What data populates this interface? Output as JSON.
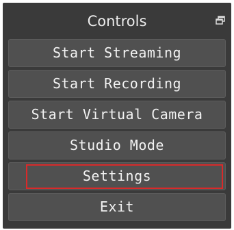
{
  "panel": {
    "title": "Controls",
    "undock_icon": "undock-float-icon"
  },
  "buttons": [
    {
      "label": "Start Streaming"
    },
    {
      "label": "Start Recording"
    },
    {
      "label": "Start Virtual Camera"
    },
    {
      "label": "Studio Mode"
    },
    {
      "label": "Settings",
      "highlighted": true,
      "highlight_color": "#d92a2a"
    },
    {
      "label": "Exit"
    }
  ],
  "colors": {
    "panel_background": "#3a3a3a",
    "button_background": "#505050",
    "text": "#f2f2f2",
    "highlight": "#d92a2a"
  }
}
